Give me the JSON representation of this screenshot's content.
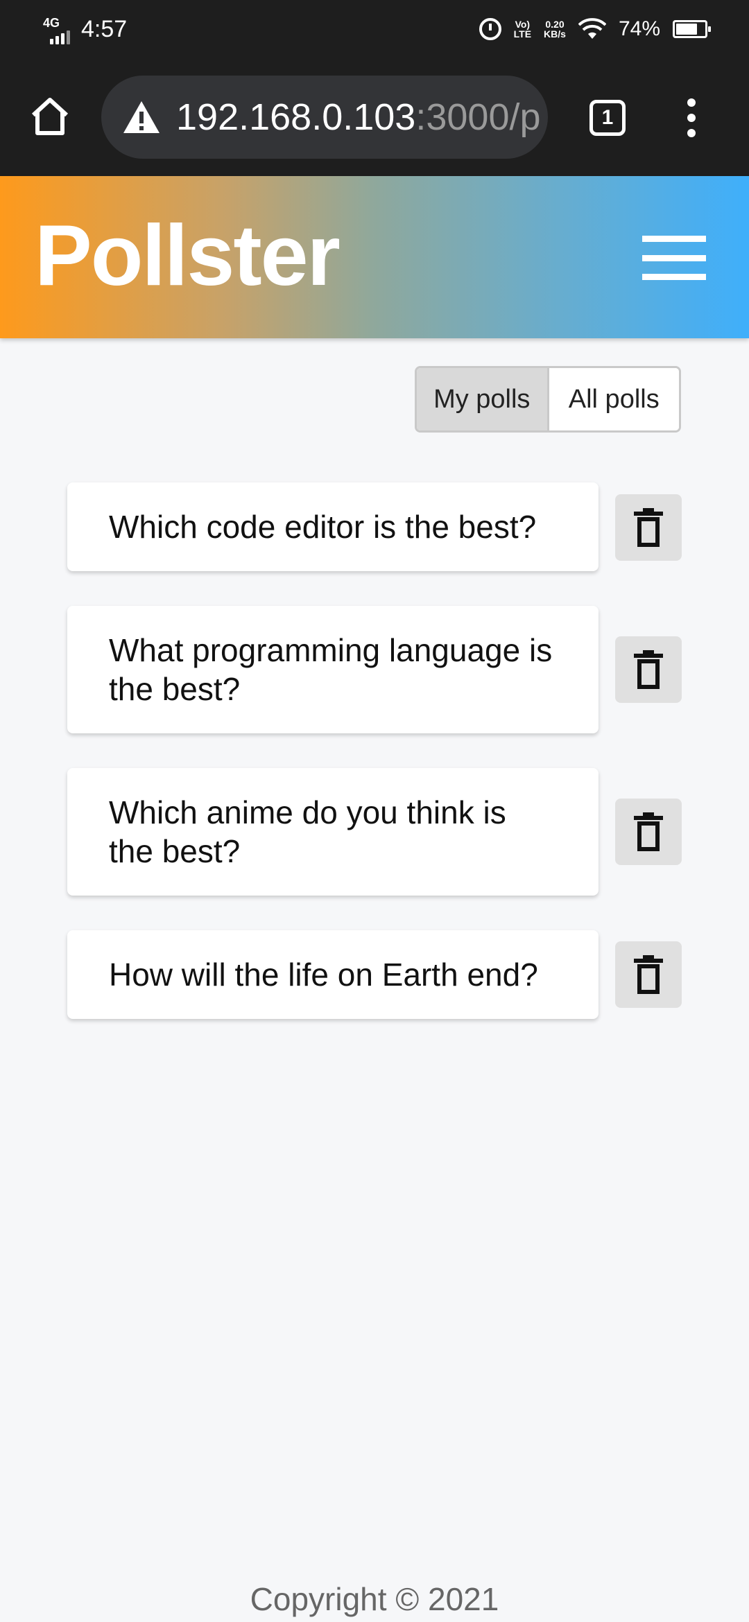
{
  "status_bar": {
    "network": "4G",
    "time": "4:57",
    "volte_top": "Vo)",
    "volte_bottom": "LTE",
    "speed_value": "0.20",
    "speed_unit": "KB/s",
    "battery": "74%",
    "battery_level": 0.74
  },
  "browser": {
    "url_host": "192.168.0.103",
    "url_rest": ":3000/p",
    "tab_count": "1"
  },
  "app": {
    "title": "Pollster",
    "colors": {
      "gradient_start": "#fe9a1c",
      "gradient_end": "#3faffb"
    }
  },
  "toggle": {
    "my_polls": "My polls",
    "all_polls": "All polls",
    "active": "My polls"
  },
  "polls": [
    {
      "question": "Which code editor is the best?"
    },
    {
      "question": "What programming language is the best?"
    },
    {
      "question": "Which anime do you think is the best?"
    },
    {
      "question": "How will the life on Earth end?"
    }
  ],
  "icons": {
    "home": "home-icon",
    "warning": "warning-icon",
    "tabs": "tabs-icon",
    "menu": "more-vert-icon",
    "hamburger": "hamburger-icon",
    "delete": "trash-icon"
  },
  "footer": {
    "copyright": "Copyright © 2021"
  }
}
